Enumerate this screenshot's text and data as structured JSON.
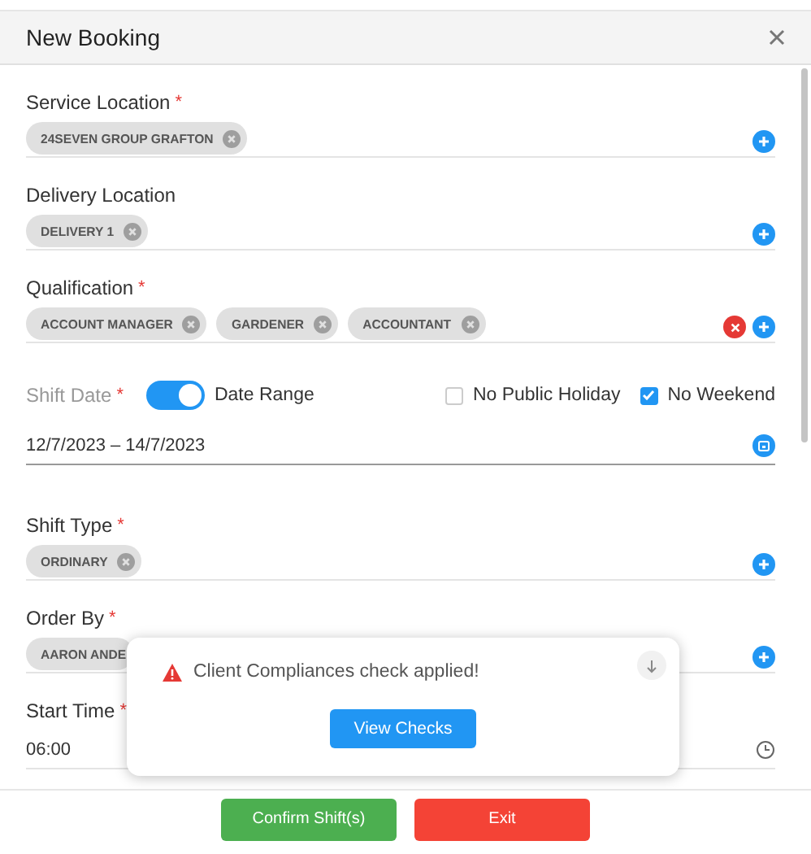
{
  "dialog": {
    "title": "New Booking"
  },
  "fields": [
    {
      "kind": "chips",
      "label": "Service Location",
      "required_mark": "*",
      "chips": [
        "24SEVEN GROUP GRAFTON"
      ]
    },
    {
      "kind": "chips",
      "label": "Delivery Location",
      "chips": [
        "DELIVERY 1"
      ]
    },
    {
      "kind": "chips",
      "label": "Qualification",
      "required_mark": "*",
      "chips": [
        "ACCOUNT MANAGER",
        "GARDENER",
        "ACCOUNTANT"
      ],
      "clearable": true
    },
    {
      "kind": "date_range",
      "label": "Shift Date",
      "required_mark": "*",
      "toggle": {
        "label": "Date Range",
        "on": true
      },
      "options": [
        {
          "label": "No Public Holiday",
          "checked": false
        },
        {
          "label": "No Weekend",
          "checked": true
        }
      ],
      "value": "12/7/2023 – 14/7/2023"
    },
    {
      "kind": "chips",
      "label": "Shift Type",
      "required_mark": "*",
      "chips": [
        "ORDINARY"
      ]
    },
    {
      "kind": "chips",
      "label": "Order By",
      "required_mark": "*",
      "chips": [
        "AARON ANDE"
      ],
      "removable": false
    },
    {
      "kind": "time",
      "label": "Start Time",
      "required_mark": "*",
      "value": "06:00"
    }
  ],
  "popup": {
    "message": "Client Compliances check applied!",
    "button": "View Checks"
  },
  "footer": {
    "buttons": [
      {
        "label": "Confirm Shift(s)",
        "kind": "confirm"
      },
      {
        "label": "Exit",
        "kind": "exit"
      }
    ]
  }
}
